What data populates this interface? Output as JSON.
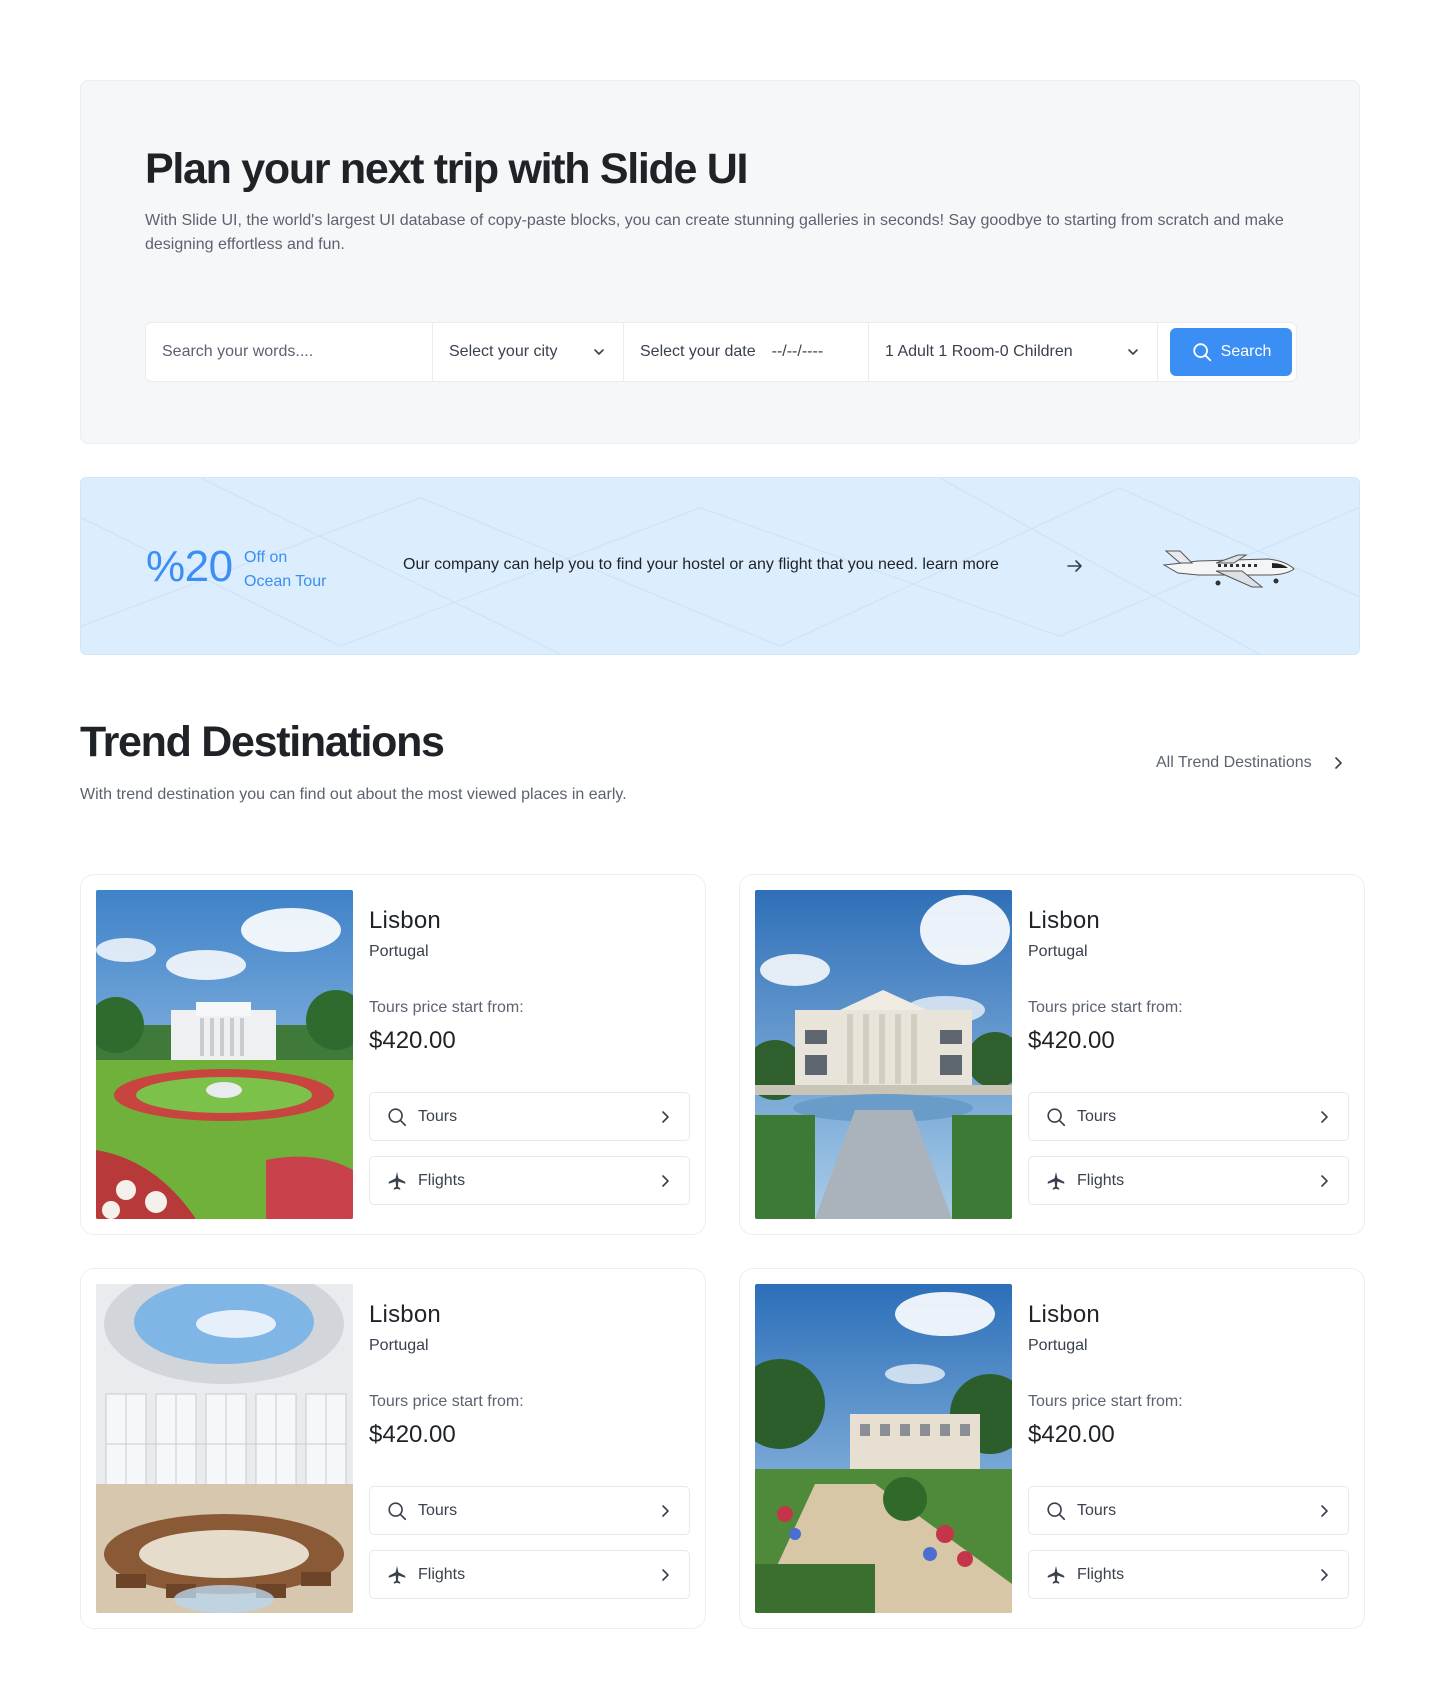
{
  "hero": {
    "title": "Plan your next trip with Slide UI",
    "subtitle": "With Slide UI, the world's largest UI database of copy-paste blocks, you can create stunning galleries in seconds! Say goodbye to starting from scratch and make designing effortless and fun.",
    "search": {
      "words_placeholder": "Search your words....",
      "city_label": "Select your city",
      "date_label": "Select your date",
      "date_value": "--/--/----",
      "guests_label": "1 Adult 1 Room-0 Children",
      "button_label": "Search"
    }
  },
  "promo": {
    "percent": "%20",
    "off_line1": "Off on",
    "off_line2": "Ocean Tour",
    "text": "Our company can help you to find your hostel or any flight that you need. learn more"
  },
  "trend": {
    "title": "Trend Destinations",
    "subtitle": "With trend destination you can find out about the most viewed places in early.",
    "all_link": "All Trend Destinations"
  },
  "cards": [
    {
      "city": "Lisbon",
      "country": "Portugal",
      "price_label": "Tours price start from:",
      "price": "$420.00",
      "tours_label": "Tours",
      "flights_label": "Flights"
    },
    {
      "city": "Lisbon",
      "country": "Portugal",
      "price_label": "Tours price start from:",
      "price": "$420.00",
      "tours_label": "Tours",
      "flights_label": "Flights"
    },
    {
      "city": "Lisbon",
      "country": "Portugal",
      "price_label": "Tours price start from:",
      "price": "$420.00",
      "tours_label": "Tours",
      "flights_label": "Flights"
    },
    {
      "city": "Lisbon",
      "country": "Portugal",
      "price_label": "Tours price start from:",
      "price": "$420.00",
      "tours_label": "Tours",
      "flights_label": "Flights"
    }
  ],
  "colors": {
    "accent": "#3b8ef3",
    "promo_bg": "#dcedfd",
    "hero_bg": "#f6f7f9"
  },
  "icons": [
    "chevron-down-icon",
    "search-icon",
    "arrow-right-icon",
    "chevron-right-icon",
    "plane-icon"
  ]
}
